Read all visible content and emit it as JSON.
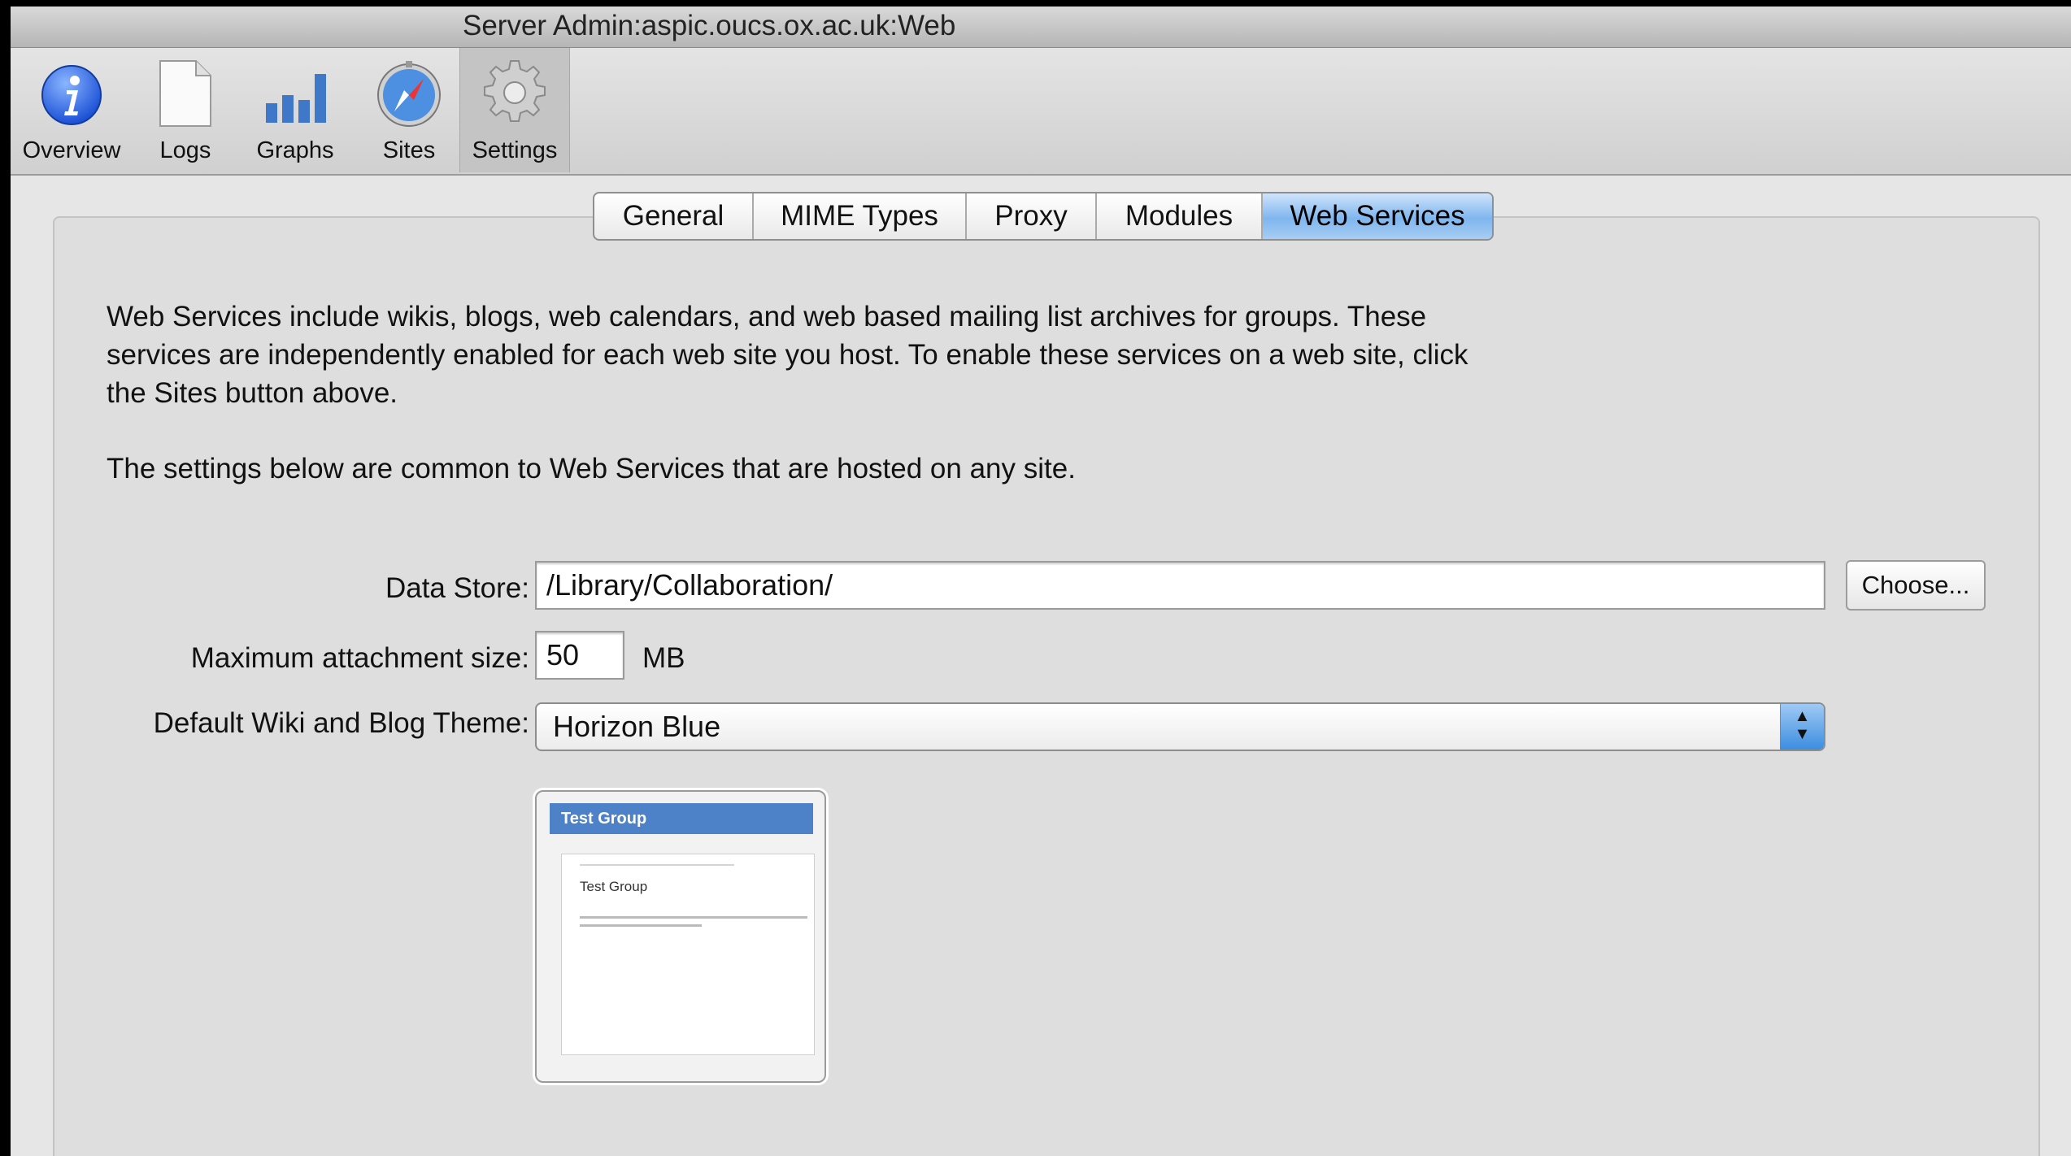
{
  "window": {
    "title": "Server Admin:aspic.oucs.ox.ac.uk:Web"
  },
  "toolbar": {
    "items": [
      {
        "label": "Overview",
        "icon": "info-icon"
      },
      {
        "label": "Logs",
        "icon": "document-icon"
      },
      {
        "label": "Graphs",
        "icon": "bar-graph-icon"
      },
      {
        "label": "Sites",
        "icon": "compass-icon"
      },
      {
        "label": "Settings",
        "icon": "gear-icon",
        "active": true
      }
    ]
  },
  "tabs": {
    "items": [
      {
        "label": "General"
      },
      {
        "label": "MIME Types"
      },
      {
        "label": "Proxy"
      },
      {
        "label": "Modules"
      },
      {
        "label": "Web Services",
        "selected": true
      }
    ]
  },
  "content": {
    "description": "Web Services include wikis, blogs, web calendars, and web based mailing list archives for groups. These services are independently enabled for each web site you host. To enable these services on a web site, click the Sites button above.",
    "note": "The settings below are common to Web Services that are hosted on any site."
  },
  "form": {
    "data_store_label": "Data Store:",
    "data_store_value": "/Library/Collaboration/",
    "choose_button": "Choose...",
    "max_attachment_label": "Maximum attachment size:",
    "max_attachment_value": "50",
    "max_attachment_unit": "MB",
    "theme_label": "Default Wiki and Blog Theme:",
    "theme_value": "Horizon Blue"
  },
  "preview": {
    "header": "Test Group",
    "title": "Test Group"
  },
  "colors": {
    "selected_tab": "#7fb6ee",
    "preview_header": "#4d82c8"
  }
}
